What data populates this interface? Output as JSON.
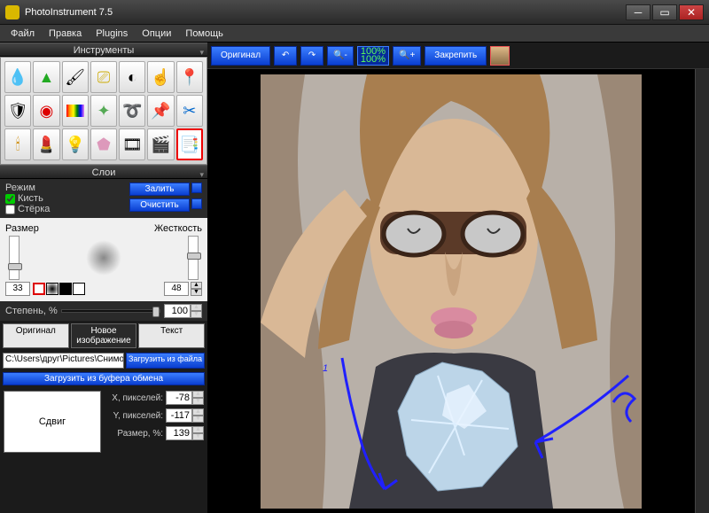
{
  "window": {
    "title": "PhotoInstrument 7.5"
  },
  "menu": {
    "file": "Файл",
    "edit": "Правка",
    "plugins": "Plugins",
    "options": "Опции",
    "help": "Помощь"
  },
  "panels": {
    "tools": "Инструменты",
    "layers": "Слои"
  },
  "layers": {
    "mode_label": "Режим",
    "brush": "Кисть",
    "eraser": "Стёрка",
    "fill": "Залить",
    "clear": "Очистить"
  },
  "brush": {
    "size_label": "Размер",
    "hardness_label": "Жесткость",
    "size_value": "33",
    "hardness_value": "48"
  },
  "degree": {
    "label": "Степень, %",
    "value": "100"
  },
  "tabs": {
    "original": "Оригинал",
    "new_image": "Новое изображение",
    "text": "Текст"
  },
  "file": {
    "path": "C:\\Users\\друг\\Pictures\\Снимок",
    "load_file": "Загрузить из файла",
    "load_clipboard": "Загрузить из буфера обмена"
  },
  "shift": {
    "label": "Сдвиг"
  },
  "params": {
    "x_label": "X, пикселей:",
    "x_value": "-78",
    "y_label": "Y, пикселей:",
    "y_value": "-117",
    "size_label": "Размер, %:",
    "size_value": "139"
  },
  "toolbar": {
    "original": "Оригинал",
    "pct1": "100%",
    "pct2": "100%",
    "pin": "Закрепить"
  },
  "colors": {
    "blue_btn": "#1a52e0",
    "accent_red": "#e00000"
  }
}
